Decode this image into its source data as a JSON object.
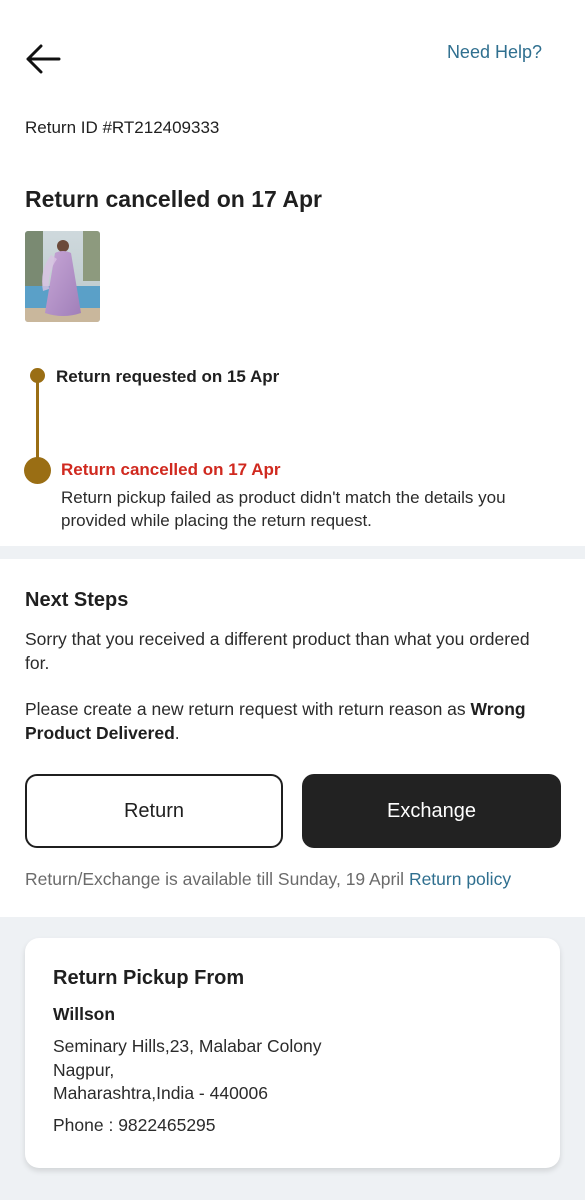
{
  "header": {
    "back_icon": "arrow-left-icon",
    "need_help": "Need Help?"
  },
  "return_info": {
    "return_id": "Return ID #RT212409333",
    "status_title": "Return cancelled on 17 Apr"
  },
  "timeline": {
    "accent_color": "#9a6e14",
    "cancel_color": "#d0291f",
    "steps": [
      {
        "label": "Return requested on 15 Apr"
      },
      {
        "label": "Return cancelled on 17 Apr",
        "description": "Return pickup failed as product didn't match the details you provided while placing the return request."
      }
    ]
  },
  "next_steps": {
    "title": "Next Steps",
    "message": "Sorry that you received a different product than what you ordered for.",
    "instruction_prefix": "Please create a new return request with return reason as ",
    "instruction_reason": "Wrong Product Delivered",
    "instruction_suffix": ".",
    "return_button": "Return",
    "exchange_button": "Exchange",
    "availability_text": "Return/Exchange is available till Sunday, 19 April",
    "return_policy_link": "Return policy"
  },
  "pickup": {
    "title": "Return Pickup From",
    "name": "Willson",
    "address_line1": "Seminary Hills,23, Malabar Colony",
    "address_line2": "Nagpur,",
    "address_line3": "Maharashtra,India - 440006",
    "phone": "Phone : 9822465295"
  }
}
